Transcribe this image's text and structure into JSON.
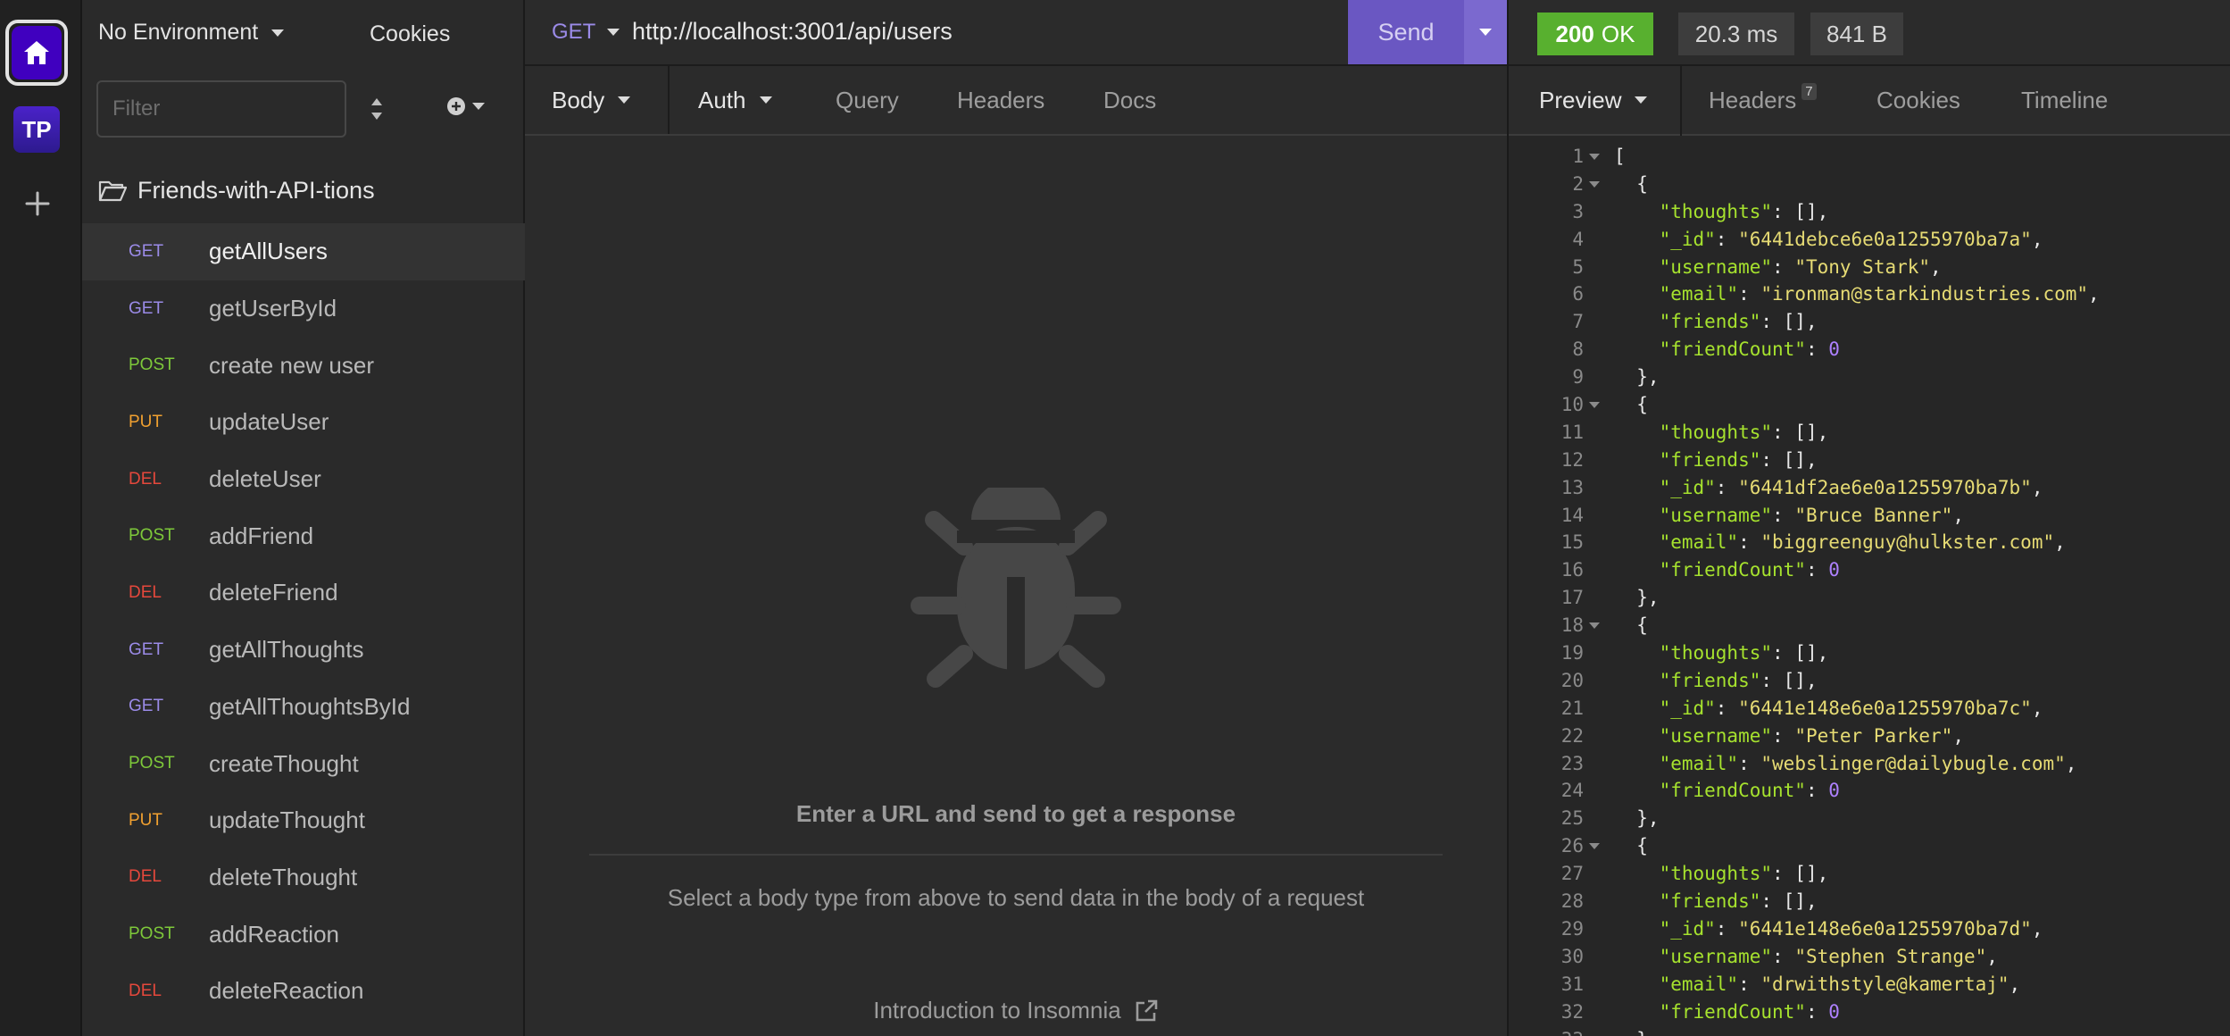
{
  "rail": {
    "home_icon": "home-icon",
    "project_badge": "TP",
    "add_icon": "plus-icon"
  },
  "sidebar": {
    "environment": "No Environment",
    "cookies": "Cookies",
    "filter_placeholder": "Filter",
    "folder": "Friends-with-API-tions",
    "requests": [
      {
        "method": "GET",
        "name": "getAllUsers",
        "active": true
      },
      {
        "method": "GET",
        "name": "getUserById"
      },
      {
        "method": "POST",
        "name": "create new user"
      },
      {
        "method": "PUT",
        "name": "updateUser"
      },
      {
        "method": "DEL",
        "name": "deleteUser"
      },
      {
        "method": "POST",
        "name": "addFriend"
      },
      {
        "method": "DEL",
        "name": "deleteFriend"
      },
      {
        "method": "GET",
        "name": "getAllThoughts"
      },
      {
        "method": "GET",
        "name": "getAllThoughtsById"
      },
      {
        "method": "POST",
        "name": "createThought"
      },
      {
        "method": "PUT",
        "name": "updateThought"
      },
      {
        "method": "DEL",
        "name": "deleteThought"
      },
      {
        "method": "POST",
        "name": "addReaction"
      },
      {
        "method": "DEL",
        "name": "deleteReaction"
      }
    ]
  },
  "colors": {
    "GET": "#9b8be8",
    "POST": "#7ec93a",
    "PUT": "#f0a030",
    "DEL": "#e5483c",
    "accent": "#6a57c2",
    "ok": "#58b02f"
  },
  "request": {
    "method": "GET",
    "url": "http://localhost:3001/api/users",
    "send": "Send",
    "tabs": [
      "Body",
      "Auth",
      "Query",
      "Headers",
      "Docs"
    ],
    "empty_title": "Enter a URL and send to get a response",
    "empty_hint": "Select a body type from above to send data in the body of a request",
    "intro_link": "Introduction to Insomnia"
  },
  "response": {
    "status_code": "200",
    "status_text": "OK",
    "time": "20.3 ms",
    "size": "841 B",
    "tabs": {
      "preview": "Preview",
      "headers": "Headers",
      "headers_count": "7",
      "cookies": "Cookies",
      "timeline": "Timeline"
    },
    "lines": [
      [
        {
          "t": "["
        }
      ],
      [
        {
          "t": "  {"
        }
      ],
      [
        {
          "t": "    "
        },
        {
          "c": "k",
          "t": "\"thoughts\""
        },
        {
          "t": ": [],"
        }
      ],
      [
        {
          "t": "    "
        },
        {
          "c": "k",
          "t": "\"_id\""
        },
        {
          "t": ": "
        },
        {
          "c": "s",
          "t": "\"6441debce6e0a1255970ba7a\""
        },
        {
          "t": ","
        }
      ],
      [
        {
          "t": "    "
        },
        {
          "c": "k",
          "t": "\"username\""
        },
        {
          "t": ": "
        },
        {
          "c": "s",
          "t": "\"Tony Stark\""
        },
        {
          "t": ","
        }
      ],
      [
        {
          "t": "    "
        },
        {
          "c": "k",
          "t": "\"email\""
        },
        {
          "t": ": "
        },
        {
          "c": "s",
          "t": "\"ironman@starkindustries.com\""
        },
        {
          "t": ","
        }
      ],
      [
        {
          "t": "    "
        },
        {
          "c": "k",
          "t": "\"friends\""
        },
        {
          "t": ": [],"
        }
      ],
      [
        {
          "t": "    "
        },
        {
          "c": "k",
          "t": "\"friendCount\""
        },
        {
          "t": ": "
        },
        {
          "c": "n",
          "t": "0"
        }
      ],
      [
        {
          "t": "  },"
        }
      ],
      [
        {
          "t": "  {"
        }
      ],
      [
        {
          "t": "    "
        },
        {
          "c": "k",
          "t": "\"thoughts\""
        },
        {
          "t": ": [],"
        }
      ],
      [
        {
          "t": "    "
        },
        {
          "c": "k",
          "t": "\"friends\""
        },
        {
          "t": ": [],"
        }
      ],
      [
        {
          "t": "    "
        },
        {
          "c": "k",
          "t": "\"_id\""
        },
        {
          "t": ": "
        },
        {
          "c": "s",
          "t": "\"6441df2ae6e0a1255970ba7b\""
        },
        {
          "t": ","
        }
      ],
      [
        {
          "t": "    "
        },
        {
          "c": "k",
          "t": "\"username\""
        },
        {
          "t": ": "
        },
        {
          "c": "s",
          "t": "\"Bruce Banner\""
        },
        {
          "t": ","
        }
      ],
      [
        {
          "t": "    "
        },
        {
          "c": "k",
          "t": "\"email\""
        },
        {
          "t": ": "
        },
        {
          "c": "s",
          "t": "\"biggreenguy@hulkster.com\""
        },
        {
          "t": ","
        }
      ],
      [
        {
          "t": "    "
        },
        {
          "c": "k",
          "t": "\"friendCount\""
        },
        {
          "t": ": "
        },
        {
          "c": "n",
          "t": "0"
        }
      ],
      [
        {
          "t": "  },"
        }
      ],
      [
        {
          "t": "  {"
        }
      ],
      [
        {
          "t": "    "
        },
        {
          "c": "k",
          "t": "\"thoughts\""
        },
        {
          "t": ": [],"
        }
      ],
      [
        {
          "t": "    "
        },
        {
          "c": "k",
          "t": "\"friends\""
        },
        {
          "t": ": [],"
        }
      ],
      [
        {
          "t": "    "
        },
        {
          "c": "k",
          "t": "\"_id\""
        },
        {
          "t": ": "
        },
        {
          "c": "s",
          "t": "\"6441e148e6e0a1255970ba7c\""
        },
        {
          "t": ","
        }
      ],
      [
        {
          "t": "    "
        },
        {
          "c": "k",
          "t": "\"username\""
        },
        {
          "t": ": "
        },
        {
          "c": "s",
          "t": "\"Peter Parker\""
        },
        {
          "t": ","
        }
      ],
      [
        {
          "t": "    "
        },
        {
          "c": "k",
          "t": "\"email\""
        },
        {
          "t": ": "
        },
        {
          "c": "s",
          "t": "\"webslinger@dailybugle.com\""
        },
        {
          "t": ","
        }
      ],
      [
        {
          "t": "    "
        },
        {
          "c": "k",
          "t": "\"friendCount\""
        },
        {
          "t": ": "
        },
        {
          "c": "n",
          "t": "0"
        }
      ],
      [
        {
          "t": "  },"
        }
      ],
      [
        {
          "t": "  {"
        }
      ],
      [
        {
          "t": "    "
        },
        {
          "c": "k",
          "t": "\"thoughts\""
        },
        {
          "t": ": [],"
        }
      ],
      [
        {
          "t": "    "
        },
        {
          "c": "k",
          "t": "\"friends\""
        },
        {
          "t": ": [],"
        }
      ],
      [
        {
          "t": "    "
        },
        {
          "c": "k",
          "t": "\"_id\""
        },
        {
          "t": ": "
        },
        {
          "c": "s",
          "t": "\"6441e148e6e0a1255970ba7d\""
        },
        {
          "t": ","
        }
      ],
      [
        {
          "t": "    "
        },
        {
          "c": "k",
          "t": "\"username\""
        },
        {
          "t": ": "
        },
        {
          "c": "s",
          "t": "\"Stephen Strange\""
        },
        {
          "t": ","
        }
      ],
      [
        {
          "t": "    "
        },
        {
          "c": "k",
          "t": "\"email\""
        },
        {
          "t": ": "
        },
        {
          "c": "s",
          "t": "\"drwithstyle@kamertaj\""
        },
        {
          "t": ","
        }
      ],
      [
        {
          "t": "    "
        },
        {
          "c": "k",
          "t": "\"friendCount\""
        },
        {
          "t": ": "
        },
        {
          "c": "n",
          "t": "0"
        }
      ],
      [
        {
          "t": "  }"
        }
      ]
    ],
    "foldable_lines": [
      1,
      2,
      10,
      18,
      26
    ]
  }
}
